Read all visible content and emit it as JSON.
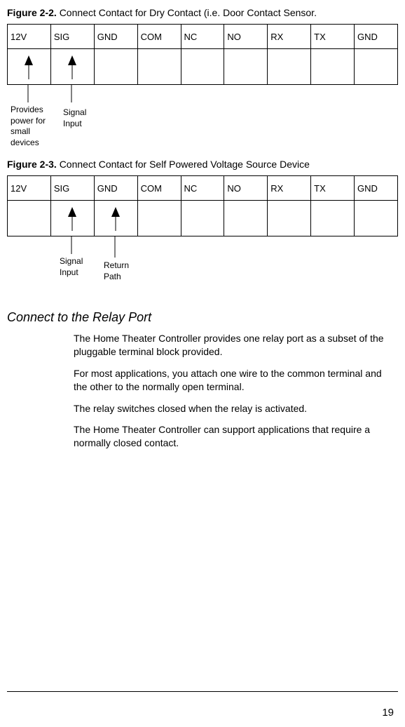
{
  "figure22": {
    "label": "Figure 2-2.",
    "caption": "Connect Contact for Dry Contact (i.e. Door Contact Sensor.",
    "pins": [
      "12V",
      "SIG",
      "GND",
      "COM",
      "NC",
      "NO",
      "RX",
      "TX",
      "GND"
    ],
    "annot1": "Provides power for small devices",
    "annot2": "Signal Input"
  },
  "figure23": {
    "label": "Figure 2-3.",
    "caption": "Connect Contact for Self Powered Voltage Source Device",
    "pins": [
      "12V",
      "SIG",
      "GND",
      "COM",
      "NC",
      "NO",
      "RX",
      "TX",
      "GND"
    ],
    "annot1": "Signal Input",
    "annot2": "Return Path"
  },
  "section": {
    "heading": "Connect to the Relay Port",
    "p1": "The Home Theater Controller provides one relay port as a subset of the pluggable terminal block provided.",
    "p2": "For most applications, you attach one wire to the common terminal and the other to the normally open terminal.",
    "p3": "The relay switches closed when the relay is activated.",
    "p4": "The Home Theater Controller can support applications that require a normally closed contact."
  },
  "pageNumber": "19"
}
